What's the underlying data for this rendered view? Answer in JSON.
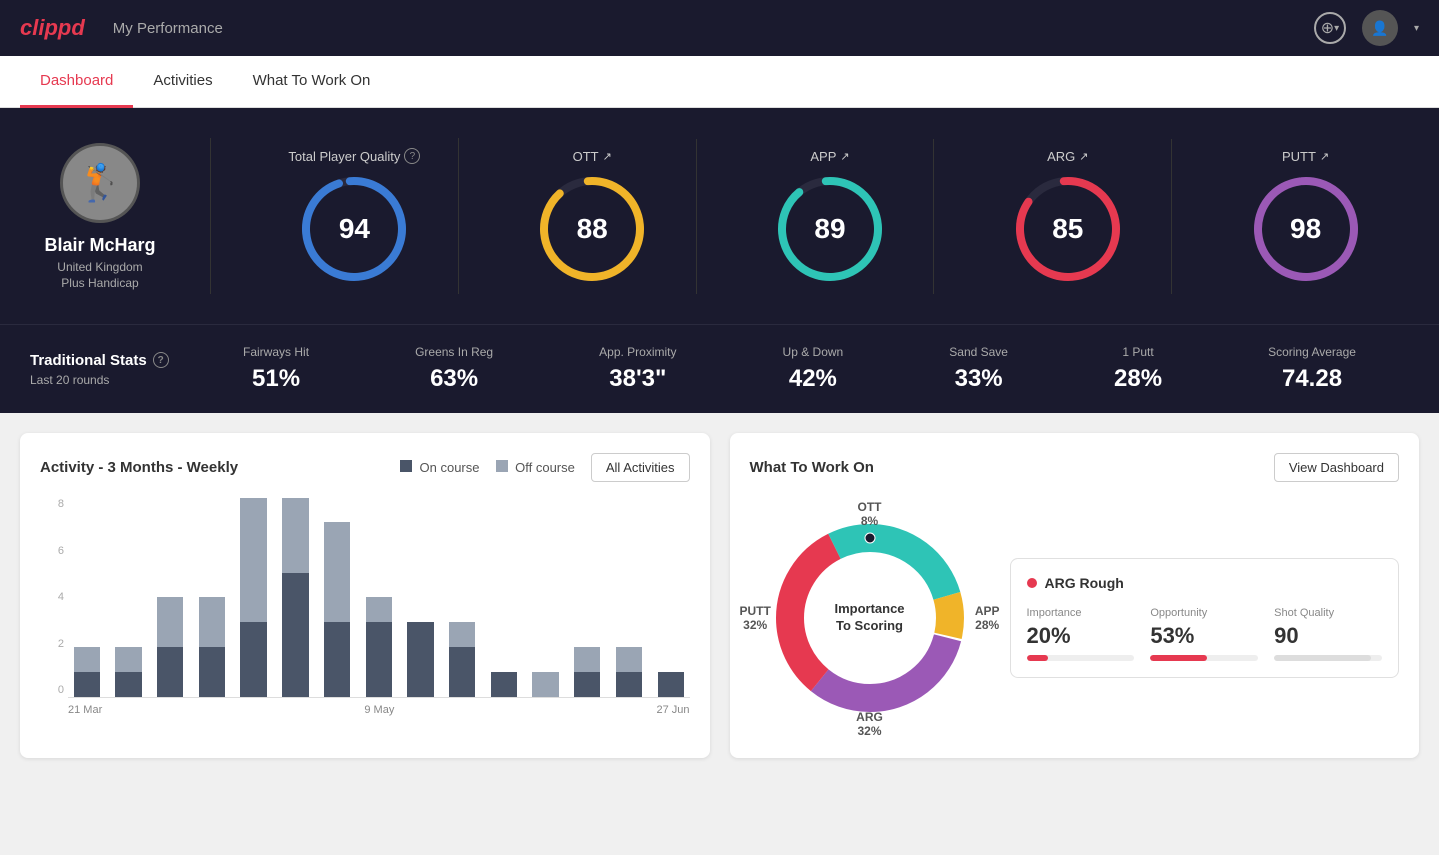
{
  "app": {
    "logo": "clippd",
    "nav_title": "My Performance"
  },
  "tabs": [
    {
      "label": "Dashboard",
      "active": true
    },
    {
      "label": "Activities",
      "active": false
    },
    {
      "label": "What To Work On",
      "active": false
    }
  ],
  "player": {
    "name": "Blair McHarg",
    "country": "United Kingdom",
    "handicap": "Plus Handicap"
  },
  "scores": {
    "total_label": "Total Player Quality",
    "total_value": "94",
    "items": [
      {
        "key": "OTT",
        "value": "88",
        "color": "#f0b429",
        "track": "#2a2a3e"
      },
      {
        "key": "APP",
        "value": "89",
        "color": "#2ec4b6",
        "track": "#2a2a3e"
      },
      {
        "key": "ARG",
        "value": "85",
        "color": "#e63950",
        "track": "#2a2a3e"
      },
      {
        "key": "PUTT",
        "value": "98",
        "color": "#9b59b6",
        "track": "#2a2a3e"
      }
    ]
  },
  "traditional_stats": {
    "title": "Traditional Stats",
    "subtitle": "Last 20 rounds",
    "items": [
      {
        "label": "Fairways Hit",
        "value": "51%"
      },
      {
        "label": "Greens In Reg",
        "value": "63%"
      },
      {
        "label": "App. Proximity",
        "value": "38'3\""
      },
      {
        "label": "Up & Down",
        "value": "42%"
      },
      {
        "label": "Sand Save",
        "value": "33%"
      },
      {
        "label": "1 Putt",
        "value": "28%"
      },
      {
        "label": "Scoring Average",
        "value": "74.28"
      }
    ]
  },
  "activity_chart": {
    "title": "Activity - 3 Months - Weekly",
    "legend_on": "On course",
    "legend_off": "Off course",
    "all_activities_btn": "All Activities",
    "x_labels": [
      "21 Mar",
      "",
      "9 May",
      "",
      "27 Jun"
    ],
    "y_labels": [
      "8",
      "6",
      "4",
      "2",
      "0"
    ],
    "bars": [
      {
        "on": 1,
        "off": 1
      },
      {
        "on": 1,
        "off": 1
      },
      {
        "on": 2,
        "off": 2
      },
      {
        "on": 2,
        "off": 2
      },
      {
        "on": 3,
        "off": 5
      },
      {
        "on": 5,
        "off": 3
      },
      {
        "on": 3,
        "off": 4
      },
      {
        "on": 3,
        "off": 1
      },
      {
        "on": 3,
        "off": 0
      },
      {
        "on": 2,
        "off": 1
      },
      {
        "on": 1,
        "off": 0
      },
      {
        "on": 0,
        "off": 1
      },
      {
        "on": 1,
        "off": 1
      },
      {
        "on": 1,
        "off": 1
      },
      {
        "on": 1,
        "off": 0
      }
    ]
  },
  "what_to_work_on": {
    "title": "What To Work On",
    "view_dashboard_btn": "View Dashboard",
    "donut_center": "Importance\nTo Scoring",
    "segments": [
      {
        "label": "OTT",
        "pct": "8%",
        "color": "#f0b429"
      },
      {
        "label": "APP",
        "pct": "28%",
        "color": "#2ec4b6"
      },
      {
        "label": "ARG",
        "pct": "32%",
        "color": "#e63950"
      },
      {
        "label": "PUTT",
        "pct": "32%",
        "color": "#9b59b6"
      }
    ],
    "card": {
      "title": "ARG Rough",
      "dot_color": "#e63950",
      "metrics": [
        {
          "label": "Importance",
          "value": "20%",
          "pct": 20,
          "color": "#e63950"
        },
        {
          "label": "Opportunity",
          "value": "53%",
          "pct": 53,
          "color": "#e63950"
        },
        {
          "label": "Shot Quality",
          "value": "90",
          "pct": 90,
          "color": "#ddd"
        }
      ]
    }
  }
}
